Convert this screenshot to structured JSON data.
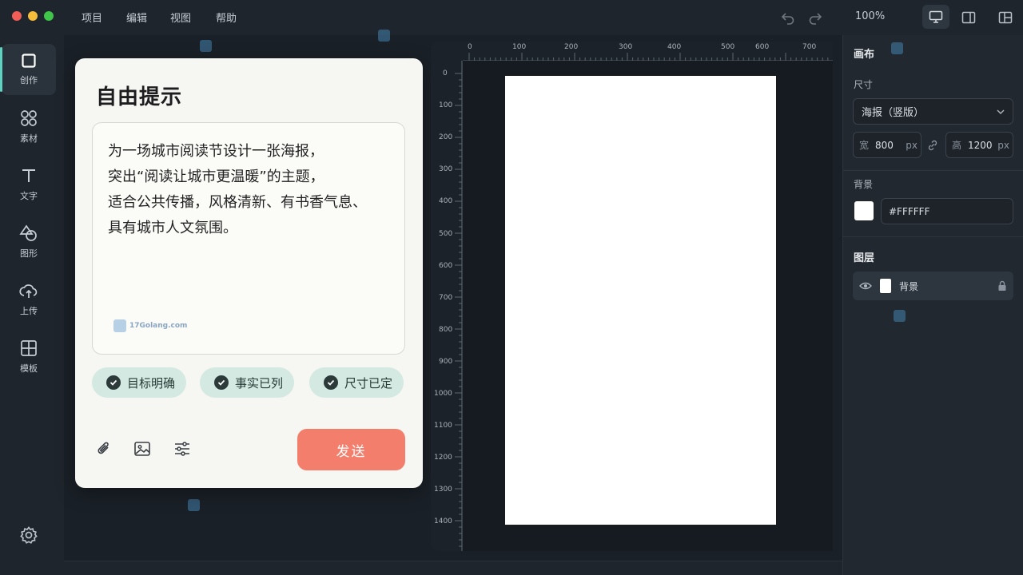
{
  "menu": {
    "items": [
      "项目",
      "编辑",
      "视图",
      "帮助"
    ],
    "zoom": "100%"
  },
  "left_toolbar": {
    "items": [
      {
        "label": "创作",
        "icon": "square-icon"
      },
      {
        "label": "素材",
        "icon": "grid-circles-icon"
      },
      {
        "label": "文字",
        "icon": "text-icon"
      },
      {
        "label": "图形",
        "icon": "shapes-icon"
      },
      {
        "label": "上传",
        "icon": "cloud-upload-icon"
      },
      {
        "label": "模板",
        "icon": "template-icon"
      }
    ]
  },
  "prompt": {
    "title": "自由提示",
    "text": "为一场城市阅读节设计一张海报，\n突出“阅读让城市更温暖”的主题，\n适合公共传播，风格清新、有书香气息、\n具有城市人文氛围。",
    "watermark": "17Golang.com",
    "chips": [
      "目标明确",
      "事实已列",
      "尺寸已定"
    ],
    "send_label": "发送"
  },
  "ruler": {
    "top": [
      "0",
      "100",
      "200",
      "300",
      "400",
      "500",
      "600",
      "700"
    ],
    "left": [
      "0",
      "100",
      "200",
      "300",
      "400",
      "500",
      "600",
      "700",
      "800",
      "900",
      "1000",
      "1100",
      "1200",
      "1300",
      "1400"
    ]
  },
  "right_panel": {
    "canvas_heading": "画布",
    "size_label": "尺寸",
    "size_select": "海报（竖版）",
    "width_prefix": "宽",
    "width_value": "800",
    "height_prefix": "高",
    "height_value": "1200",
    "unit": "px",
    "background_label": "背景",
    "background_hex": "#FFFFFF",
    "layers_heading": "图层",
    "layer_name": "背景"
  },
  "colors": {
    "accent": "#5fd3c0",
    "send": "#f47e6c",
    "chip_bg": "#d5e9e3"
  }
}
